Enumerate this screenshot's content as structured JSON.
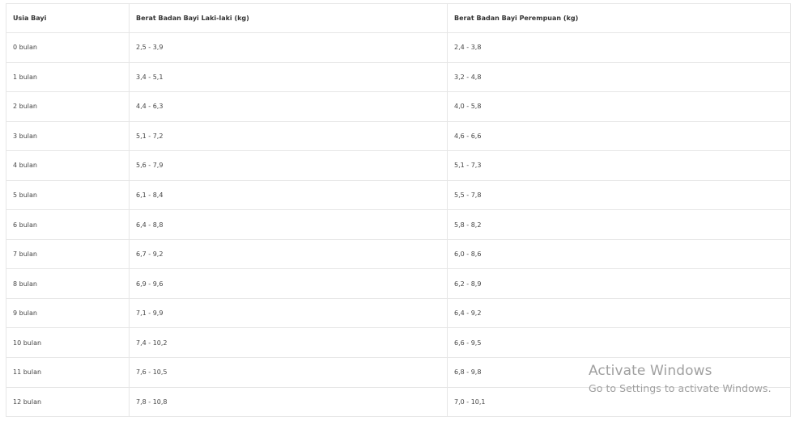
{
  "table": {
    "headers": {
      "age": "Usia Bayi",
      "boy": "Berat Badan Bayi Laki-laki (kg)",
      "girl": "Berat Badan Bayi Perempuan (kg)"
    },
    "rows": [
      {
        "age": "0 bulan",
        "boy": "2,5 - 3,9",
        "girl": "2,4 - 3,8"
      },
      {
        "age": "1 bulan",
        "boy": "3,4 - 5,1",
        "girl": "3,2 - 4,8"
      },
      {
        "age": "2 bulan",
        "boy": "4,4 - 6,3",
        "girl": "4,0 - 5,8"
      },
      {
        "age": "3 bulan",
        "boy": "5,1 - 7,2",
        "girl": "4,6 - 6,6"
      },
      {
        "age": "4 bulan",
        "boy": "5,6 - 7,9",
        "girl": "5,1 - 7,3"
      },
      {
        "age": "5 bulan",
        "boy": "6,1 - 8,4",
        "girl": "5,5 - 7,8"
      },
      {
        "age": "6 bulan",
        "boy": "6,4 - 8,8",
        "girl": "5,8 - 8,2"
      },
      {
        "age": "7 bulan",
        "boy": "6,7 - 9,2",
        "girl": "6,0 - 8,6"
      },
      {
        "age": "8 bulan",
        "boy": "6,9 - 9,6",
        "girl": "6,2 - 8,9"
      },
      {
        "age": "9 bulan",
        "boy": "7,1 - 9,9",
        "girl": "6,4 - 9,2"
      },
      {
        "age": "10 bulan",
        "boy": "7,4 - 10,2",
        "girl": "6,6 - 9,5"
      },
      {
        "age": "11 bulan",
        "boy": "7,6 - 10,5",
        "girl": "6,8 - 9,8"
      },
      {
        "age": "12 bulan",
        "boy": "7,8 - 10,8",
        "girl": "7,0 - 10,1"
      }
    ]
  },
  "watermark": {
    "title": "Activate Windows",
    "subtitle": "Go to Settings to activate Windows."
  }
}
